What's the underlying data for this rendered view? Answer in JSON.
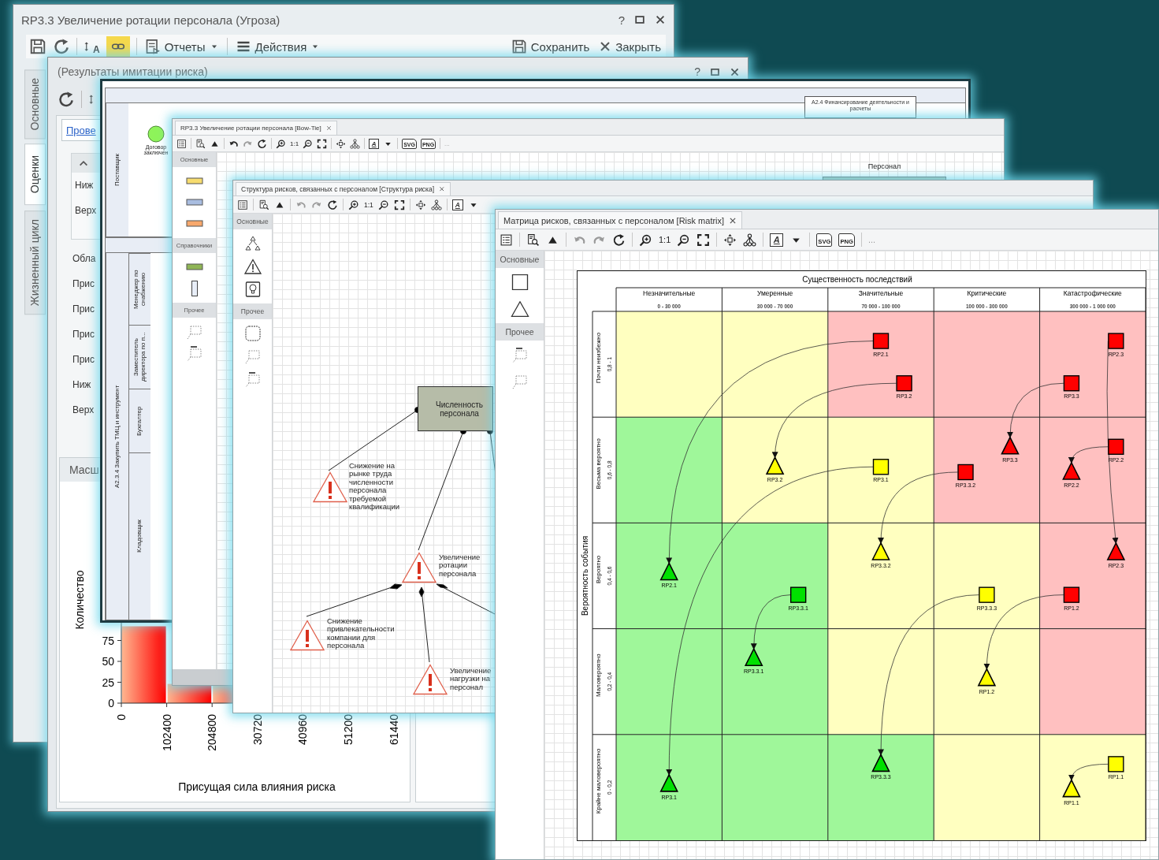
{
  "threat_window": {
    "title": "RP3.3 Увеличение ротации персонала (Угроза)",
    "help": "?",
    "toolbar": {
      "sort_label": "A",
      "link_active": true,
      "reports": "Отчеты",
      "actions": "Действия",
      "save": "Сохранить",
      "close": "Закрыть"
    },
    "side_tabs": [
      {
        "label": "Основные",
        "selected": false
      },
      {
        "label": "Оценки",
        "selected": true
      },
      {
        "label": "Жизненный цикл",
        "selected": false
      }
    ]
  },
  "simulation_window": {
    "title": "(Результаты имитации риска)",
    "help": "?",
    "link": "Прове",
    "filter_fields": [
      "Ниж",
      "Верх"
    ],
    "fields": [
      "Обла",
      "Прис",
      "Прис",
      "Прис",
      "Прис",
      "Ниж",
      "Верх"
    ],
    "chart_panel": {
      "title": "Масш",
      "xlabel": "Присущая сила влияния риска",
      "ylabel": "Количество",
      "x_tick_labels": [
        "0",
        "102400",
        "204800",
        "30720",
        "40960",
        "51200",
        "61440"
      ],
      "y_tick_labels": [
        "75",
        "50",
        "25",
        "0"
      ]
    }
  },
  "process_window": {
    "node": "A2.4 Финансирование деятельности и расчеты",
    "pools": [
      {
        "label": "Поставщик",
        "event": "Договор заключен"
      },
      {
        "label": "A2.3.4 Закупить ТМЦ и инструмент",
        "lanes": [
          "Менеджер по снабжению",
          "Заместитель директора по п...",
          "Бухгалтер",
          "Кладовщик"
        ]
      }
    ]
  },
  "bowtie_window": {
    "tab": "RP3.3 Увеличение ротации персонала [Bow-Tie]",
    "toolbar": {
      "undo_disabled": false,
      "zoom_label": "1:1",
      "text_tool": "A",
      "export": [
        "SVG",
        "PNG"
      ],
      "more": "..."
    },
    "palette": [
      {
        "header": "Основные",
        "items": [
          {
            "kind": "swatch",
            "color": "#f7dc6f"
          },
          {
            "kind": "swatch",
            "color": "#a9bde0"
          },
          {
            "kind": "swatch",
            "color": "#f7a86c"
          }
        ]
      },
      {
        "header": "Справочники",
        "items": [
          {
            "kind": "swatch",
            "color": "#8fb556"
          },
          {
            "kind": "bar"
          }
        ]
      },
      {
        "header": "Прочее",
        "items": [
          {
            "kind": "note"
          },
          {
            "kind": "header-note"
          }
        ]
      }
    ],
    "canvas_label": "Персонал"
  },
  "structure_window": {
    "tab": "Структура рисков, связанных с персоналом [Структура риска]",
    "toolbar": {
      "undo_disabled": true,
      "zoom_label": "1:1",
      "text_tool": "A"
    },
    "palette": [
      {
        "header": "Основные",
        "items": [
          {
            "kind": "hierarchy"
          },
          {
            "kind": "warning"
          },
          {
            "kind": "bulb"
          }
        ]
      },
      {
        "header": "Прочее",
        "items": [
          {
            "kind": "rounded"
          },
          {
            "kind": "note"
          },
          {
            "kind": "header-note"
          }
        ]
      }
    ],
    "nodes": [
      {
        "kind": "factor",
        "label": "Численность персонала"
      },
      {
        "kind": "risk",
        "label": "Снижение на рынке труда численности персонала требуемой квалификации"
      },
      {
        "kind": "risk",
        "label": "Увеличение ротации персонала"
      },
      {
        "kind": "risk",
        "label": "Снижение привлекательности компании для персонала"
      },
      {
        "kind": "risk",
        "label": "Увеличение нагрузки на персонал"
      }
    ]
  },
  "matrix_window": {
    "tab": "Матрица рисков, связанных с персоналом [Risk matrix]",
    "toolbar": {
      "undo_disabled": true,
      "zoom_label": "1:1",
      "text_tool": "A",
      "export": [
        "SVG",
        "PNG"
      ],
      "more": "..."
    },
    "palette": [
      {
        "header": "Основные",
        "items": [
          {
            "kind": "square"
          },
          {
            "kind": "triangle"
          }
        ]
      },
      {
        "header": "Прочее",
        "items": [
          {
            "kind": "header-note"
          },
          {
            "kind": "note"
          }
        ]
      }
    ],
    "matrix": {
      "title": "Существенность последствий",
      "axis_title": "Вероятность события",
      "columns": [
        {
          "label": "Незначительные",
          "range": "0 - 30 000"
        },
        {
          "label": "Умеренные",
          "range": "30 000 - 70 000"
        },
        {
          "label": "Значительные",
          "range": "70 000 - 100 000"
        },
        {
          "label": "Критические",
          "range": "100 000 - 300 000"
        },
        {
          "label": "Катастрофические",
          "range": "300 000 - 1 000 000"
        }
      ],
      "rows": [
        {
          "label": "Почти неизбежно",
          "range": "0,8 - 1",
          "cells": [
            {
              "color": "#ffffc0"
            },
            {
              "color": "#ffffc0"
            },
            {
              "color": "#ffc0c0"
            },
            {
              "color": "#ffc0c0"
            },
            {
              "color": "#ffc0c0"
            }
          ]
        },
        {
          "label": "Весьма вероятно",
          "range": "0,6 - 0,8",
          "cells": [
            {
              "color": "#9ff79a"
            },
            {
              "color": "#ffffc0"
            },
            {
              "color": "#ffffc0"
            },
            {
              "color": "#ffc0c0"
            },
            {
              "color": "#ffc0c0"
            }
          ]
        },
        {
          "label": "Вероятно",
          "range": "0,4 - 0,6",
          "cells": [
            {
              "color": "#9ff79a"
            },
            {
              "color": "#9ff79a"
            },
            {
              "color": "#ffffc0"
            },
            {
              "color": "#ffffc0"
            },
            {
              "color": "#ffc0c0"
            }
          ]
        },
        {
          "label": "Маловероятно",
          "range": "0,2 - 0,4",
          "cells": [
            {
              "color": "#9ff79a"
            },
            {
              "color": "#9ff79a"
            },
            {
              "color": "#ffffc0"
            },
            {
              "color": "#ffffc0"
            },
            {
              "color": "#ffc0c0"
            }
          ]
        },
        {
          "label": "Крайне маловероятно",
          "range": "0 - 0,2",
          "cells": [
            {
              "color": "#9ff79a"
            },
            {
              "color": "#9ff79a"
            },
            {
              "color": "#9ff79a"
            },
            {
              "color": "#ffffc0"
            },
            {
              "color": "#ffffc0"
            }
          ]
        }
      ],
      "risks": [
        {
          "inherent": {
            "label": "RP2.1",
            "color": "#ff0000"
          },
          "residual": {
            "label": "RP2.1",
            "color": "#00e000"
          }
        },
        {
          "inherent": {
            "label": "RP3.2",
            "color": "#ff0000"
          },
          "residual": {
            "label": "RP3.2",
            "color": "#ffff00"
          }
        },
        {
          "inherent": {
            "label": "RP3.3",
            "color": "#ff0000"
          },
          "residual": {
            "label": "RP3.3",
            "color": "#ff0000"
          }
        },
        {
          "inherent": {
            "label": "RP2.3",
            "color": "#ff0000"
          },
          "residual": {
            "label": "RP2.3",
            "color": "#ff0000"
          }
        },
        {
          "inherent": {
            "label": "RP2.2",
            "color": "#ff0000"
          },
          "residual": {
            "label": "RP2.2",
            "color": "#ff0000"
          }
        },
        {
          "inherent": {
            "label": "RP3.1",
            "color": "#ffff00"
          },
          "residual": {
            "label": "RP3.1",
            "color": "#00e000"
          }
        },
        {
          "inherent": {
            "label": "RP3.3.2",
            "color": "#ff0000"
          },
          "residual": {
            "label": "RP3.3.2",
            "color": "#ffff00"
          }
        },
        {
          "inherent": {
            "label": "RP3.3.1",
            "color": "#00e000"
          },
          "residual": {
            "label": "RP3.3.1",
            "color": "#00e000"
          }
        },
        {
          "inherent": {
            "label": "RP3.3.3",
            "color": "#ffff00"
          },
          "residual": {
            "label": "RP3.3.3",
            "color": "#00e000"
          }
        },
        {
          "inherent": {
            "label": "RP1.2",
            "color": "#ff0000"
          },
          "residual": {
            "label": "RP1.2",
            "color": "#ffff00"
          }
        },
        {
          "inherent": {
            "label": "RP1.1",
            "color": "#ffff00"
          },
          "residual": {
            "label": "RP1.1",
            "color": "#ffff00"
          }
        }
      ]
    }
  }
}
